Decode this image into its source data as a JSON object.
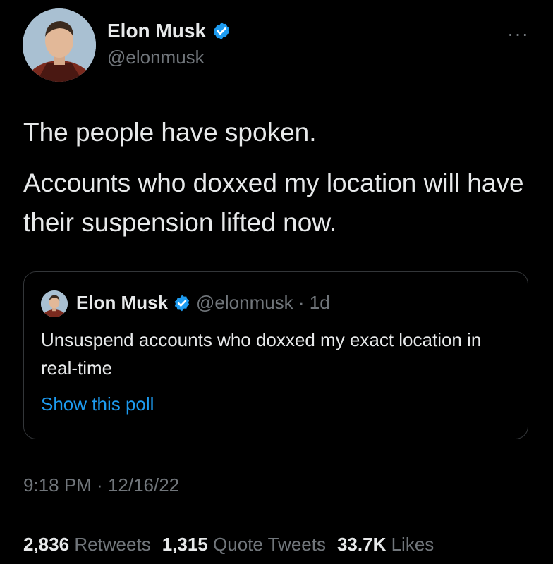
{
  "author": {
    "name": "Elon Musk",
    "handle": "@elonmusk"
  },
  "tweet": {
    "line1": "The people have spoken.",
    "line2": "Accounts who doxxed my location will have their suspension lifted now."
  },
  "quoted": {
    "name": "Elon Musk",
    "handle_time": "@elonmusk · 1d",
    "text": "Unsuspend accounts who doxxed my exact location in real-time",
    "link": "Show this poll"
  },
  "timestamp": "9:18 PM · 12/16/22",
  "stats": {
    "retweets_count": "2,836",
    "retweets_label": "Retweets",
    "quotes_count": "1,315",
    "quotes_label": "Quote Tweets",
    "likes_count": "33.7K",
    "likes_label": "Likes"
  },
  "icons": {
    "more": "more-horizontal-icon",
    "verified": "verified-badge-icon"
  },
  "colors": {
    "background": "#000000",
    "primary_text": "#e7e9ea",
    "secondary_text": "#71767b",
    "link": "#1d9bf0",
    "verified": "#1d9bf0"
  }
}
